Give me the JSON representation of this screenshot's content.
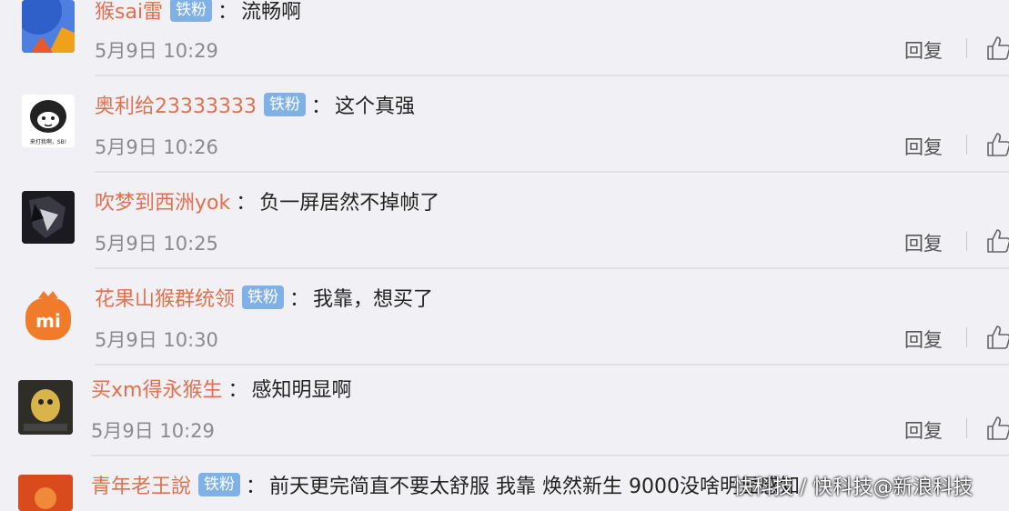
{
  "comments": [
    {
      "username": "猴sai雷",
      "badge": "铁粉",
      "text": "流畅啊",
      "time": "5月9日 10:29",
      "reply": "回复"
    },
    {
      "username": "奥利给23333333",
      "badge": "铁粉",
      "text": "这个真强",
      "time": "5月9日 10:26",
      "reply": "回复",
      "avatar_caption": "来打我啊，SB!"
    },
    {
      "username": "吹梦到西洲yok",
      "badge": "",
      "text": "负一屏居然不掉帧了",
      "time": "5月9日 10:25",
      "reply": "回复"
    },
    {
      "username": "花果山猴群统领",
      "badge": "铁粉",
      "text": "我靠，想买了",
      "time": "5月9日 10:30",
      "reply": "回复",
      "avatar_logo": "mi"
    },
    {
      "username": "买xm得永猴生",
      "badge": "",
      "text": "感知明显啊",
      "time": "5月9日 10:29",
      "reply": "回复"
    },
    {
      "username": "青年老王說",
      "badge": "铁粉",
      "text": "前天更完简直不要太舒服 我靠 焕然新生 9000没啥明显感知"
    }
  ],
  "colon": "：",
  "watermark": "快科技 / 快科技@新浪科技",
  "colors": {
    "username": "#e0704e",
    "badge_bg": "#7fb0e6",
    "time": "#8a8a8e",
    "background": "#f1f0f5"
  },
  "icons": {
    "like": "thumbs-up-icon"
  }
}
